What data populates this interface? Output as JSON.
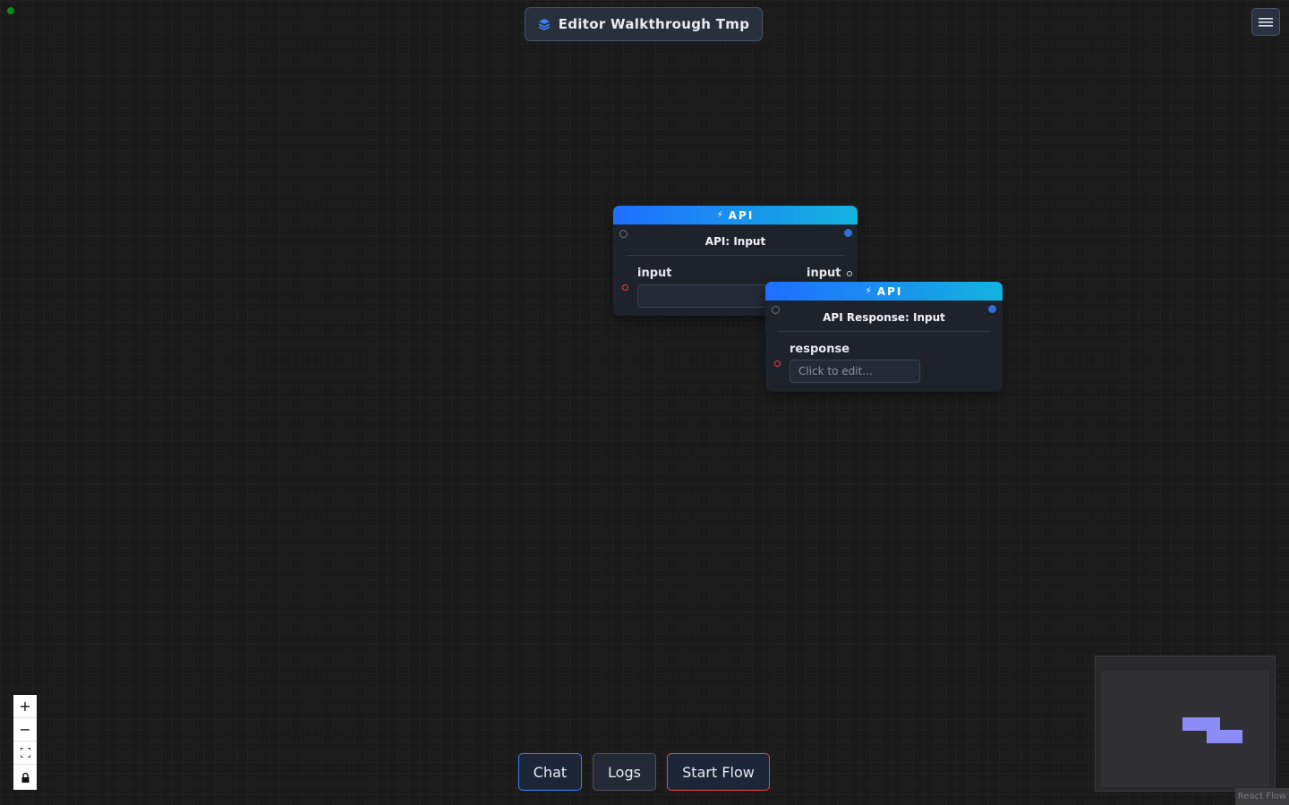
{
  "header": {
    "title": "Editor Walkthrough Tmp",
    "icon": "layers-icon"
  },
  "menu": {
    "icon": "hamburger-menu-icon"
  },
  "nodes": [
    {
      "category": "API",
      "category_icon": "lightning-icon",
      "title": "API: Input",
      "field_label": "input",
      "output_label": "input",
      "field_value": ""
    },
    {
      "category": "API",
      "category_icon": "lightning-icon",
      "title": "API Response: Input",
      "field_label": "response",
      "field_placeholder": "Click to edit..."
    }
  ],
  "controls": {
    "zoom_in": "+",
    "zoom_out": "−",
    "fit_view": "fit-view-icon",
    "lock": "lock-icon"
  },
  "actions": {
    "chat_label": "Chat",
    "logs_label": "Logs",
    "start_flow_label": "Start Flow"
  },
  "colors": {
    "node_header_gradient_start": "#1f6fff",
    "node_header_gradient_end": "#13b3de",
    "chat_border": "#3b82f6",
    "logs_border": "#4b5563",
    "start_flow_border": "#e5484d",
    "status_dot": "#0e8a16",
    "minimap_node": "#8b8cf5"
  },
  "attribution": "React Flow"
}
